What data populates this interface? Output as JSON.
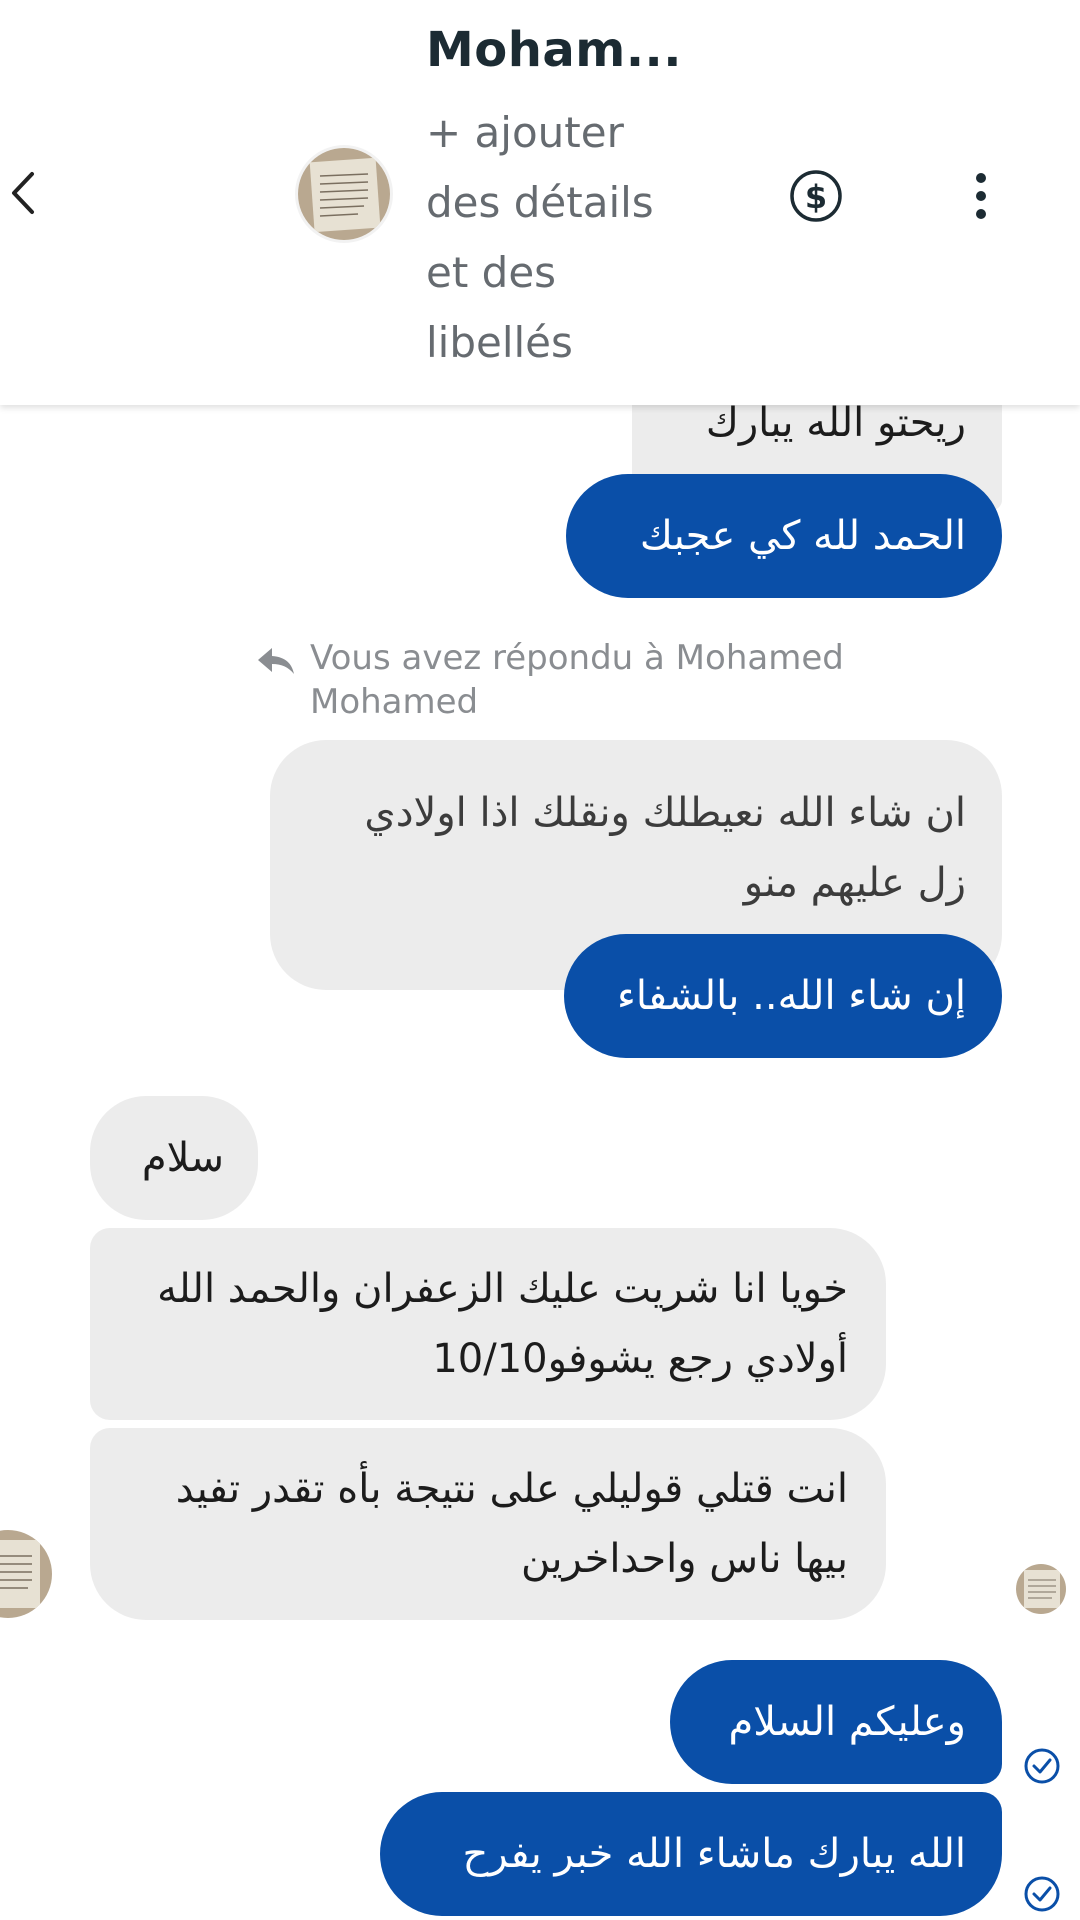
{
  "header": {
    "title": "Moham...",
    "subtitle": "+ ajouter des détails et des libellés",
    "back_icon": "chevron-left-icon",
    "payment_icon": "dollar-circle-icon",
    "menu_icon": "more-vertical-icon"
  },
  "thread": {
    "partial_top": "ريحتو الله يبارك",
    "msg_out_1": "الحمد لله كي عجبك",
    "reply_note": "Vous avez répondu à Mohamed Mohamed",
    "quoted_msg": "ان شاء الله نعيطلك ونقلك اذا اولادي زل عليهم منو",
    "msg_out_2": "إن شاء الله.. بالشفاء",
    "msg_in_1": "سلام",
    "msg_in_2": "خويا انا شريت عليك الزعفران والحمد الله أولادي رجع يشوفو10/10",
    "msg_in_3": "انت قتلي قوليلي على نتيجة بأه تقدر تفيد بيها ناس واحداخرين",
    "msg_out_3": "وعليكم السلام",
    "msg_out_4": "الله يبارك ماشاء الله خبر يفرح"
  },
  "colors": {
    "outgoing_bubble": "#0a4fa8",
    "incoming_bubble": "#ececec",
    "seen_check": "#0a4fa8"
  }
}
